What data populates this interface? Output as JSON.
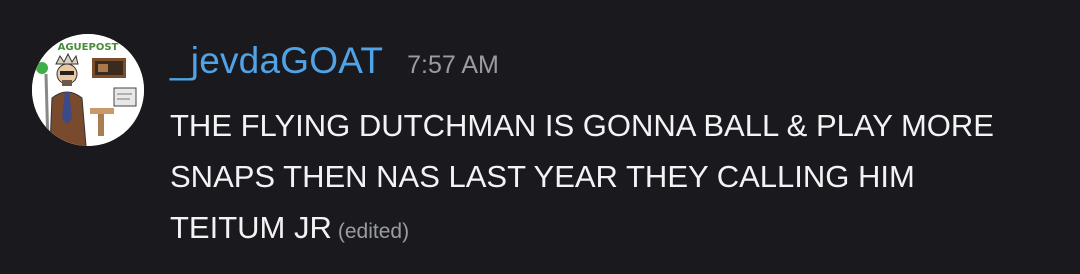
{
  "message": {
    "author": {
      "username": "_jevdaGOAT",
      "username_color": "#4fa3e6",
      "avatar_text": "AGUEPOST"
    },
    "timestamp": "7:57 AM",
    "text": "THE FLYING DUTCHMAN IS GONNA BALL & PLAY MORE SNAPS THEN NAS LAST YEAR THEY CALLING HIM TEITUM JR",
    "edited_label": "(edited)"
  },
  "theme": {
    "background": "#1a1a1e",
    "text": "#f2f3f5",
    "muted": "#9a9ca3"
  }
}
